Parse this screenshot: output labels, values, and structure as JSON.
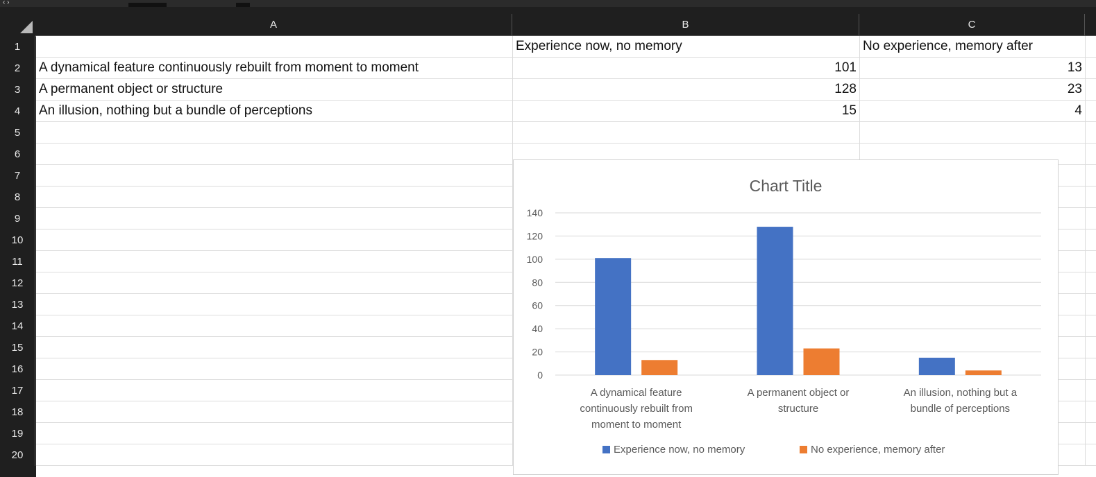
{
  "columns": [
    "A",
    "B",
    "C"
  ],
  "row_numbers": [
    "1",
    "2",
    "3",
    "4",
    "5",
    "6",
    "7",
    "8",
    "9",
    "10",
    "11",
    "12",
    "13",
    "14",
    "15",
    "16",
    "17",
    "18",
    "19",
    "20"
  ],
  "cells": {
    "B1": "Experience now, no memory",
    "C1": "No experience, memory after",
    "A2": "A dynamical feature continuously rebuilt from moment to moment",
    "B2": "101",
    "C2": "13",
    "A3": "A permanent object or structure",
    "B3": "128",
    "C3": "23",
    "A4": "An illusion, nothing but a bundle of perceptions",
    "B4": "15",
    "C4": "4"
  },
  "chart_data": {
    "type": "bar",
    "title": "Chart Title",
    "categories": [
      [
        "A dynamical feature",
        "continuously rebuilt from",
        "moment to moment"
      ],
      [
        "A permanent object or",
        "structure"
      ],
      [
        "An illusion, nothing but a",
        "bundle of perceptions"
      ]
    ],
    "series": [
      {
        "name": "Experience now, no memory",
        "values": [
          101,
          128,
          15
        ],
        "color": "#4472c4"
      },
      {
        "name": "No experience, memory after",
        "values": [
          13,
          23,
          4
        ],
        "color": "#ed7d31"
      }
    ],
    "yticks": [
      "0",
      "20",
      "40",
      "60",
      "80",
      "100",
      "120",
      "140"
    ],
    "ylim": [
      0,
      140
    ],
    "grid": true,
    "legend_position": "bottom"
  }
}
